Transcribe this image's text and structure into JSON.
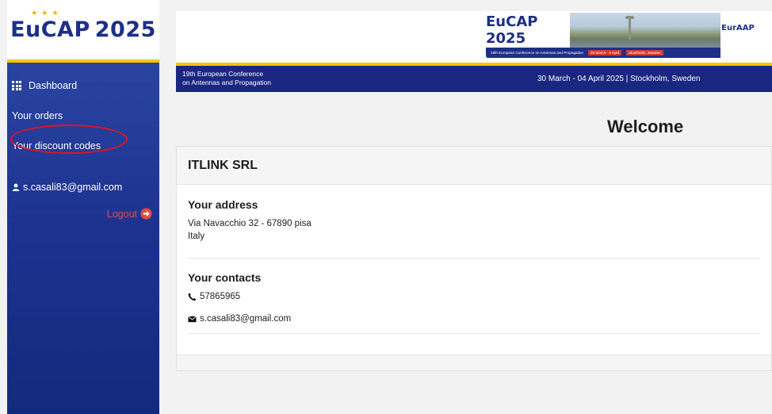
{
  "sidebar": {
    "logo": {
      "brand": "EuCAP",
      "year": "2025",
      "stars": "★ ★ ★"
    },
    "nav": [
      {
        "label": "Dashboard",
        "icon": "grid-icon"
      },
      {
        "label": "Your orders"
      },
      {
        "label": "Your discount codes",
        "highlighted": true
      }
    ],
    "user_email": "s.casali83@gmail.com",
    "logout_label": "Logout"
  },
  "header": {
    "banner": {
      "logo": "EuCAP 2025",
      "bar_text": "19th European Conference on Antennas and Propagation",
      "bar_dates": "30 March - 4 April",
      "bar_place": "Stockholm, Sweden",
      "association": "EurAAP"
    },
    "conference_line1": "19th European Conference",
    "conference_line2": "on Antennas and Propagation",
    "dates": "30 March - 04 April 2025 | Stockholm, Sweden"
  },
  "main": {
    "welcome": "Welcome",
    "company": "ITLINK SRL",
    "address": {
      "title": "Your address",
      "line1": "Via Navacchio 32 - 67890 pisa",
      "line2": "Italy"
    },
    "contacts": {
      "title": "Your contacts",
      "phone": "57865965",
      "email": "s.casali83@gmail.com"
    }
  },
  "colors": {
    "sidebar_top": "#2f4aa8",
    "sidebar_bottom": "#132a7c",
    "accent_yellow": "#f4c400",
    "logout_red": "#e84a3c",
    "highlight_ring": "#e0151d",
    "navy": "#1a2781"
  }
}
